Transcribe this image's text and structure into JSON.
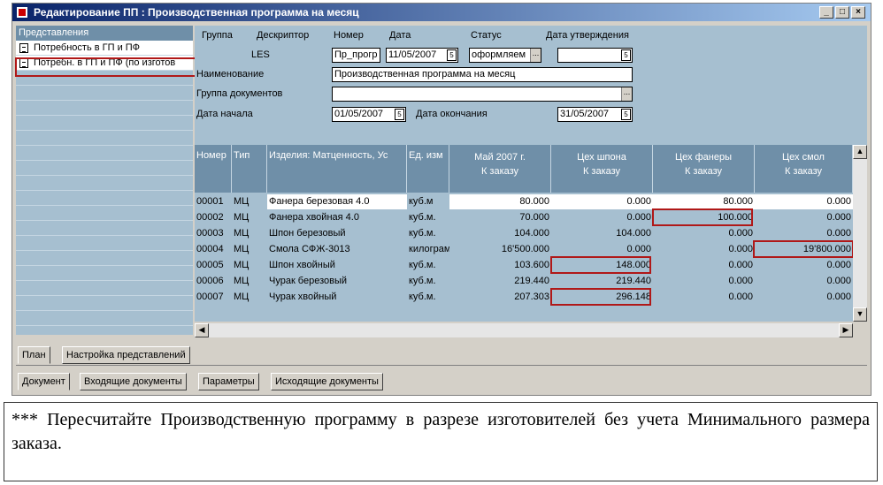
{
  "window": {
    "title": "Редактирование ПП : Производственная программа на месяц"
  },
  "title_buttons": [
    "_",
    "□",
    "×"
  ],
  "left_panel": {
    "header": "Представления",
    "items": [
      "Потребность в ГП и ПФ",
      "Потребн. в ГП и ПФ (по изготов"
    ]
  },
  "form": {
    "labels": {
      "group": "Группа",
      "descriptor": "Дескриптор",
      "number": "Номер",
      "date": "Дата",
      "status": "Статус",
      "approval_date": "Дата утверждения",
      "name": "Наименование",
      "doc_group": "Группа документов",
      "start_date": "Дата начала",
      "end_date": "Дата окончания"
    },
    "values": {
      "descriptor": "LES",
      "number": "Пр_прогр",
      "date": "11/05/2007",
      "status": "оформляем",
      "approval_date": "",
      "name": "Производственная программа на месяц",
      "doc_group": "",
      "start_date": "01/05/2007",
      "end_date": "31/05/2007"
    }
  },
  "grid": {
    "columns": [
      {
        "id": "num",
        "label": "Номер"
      },
      {
        "id": "type",
        "label": "Тип"
      },
      {
        "id": "item",
        "label": "Изделия: Матценность, Ус"
      },
      {
        "id": "unit",
        "label": "Ед. изм"
      },
      {
        "id": "may",
        "label1": "Май 2007 г.",
        "label2": "К заказу"
      },
      {
        "id": "veneer",
        "label1": "Цех шпона",
        "label2": "К заказу"
      },
      {
        "id": "plywood",
        "label1": "Цех фанеры",
        "label2": "К заказу"
      },
      {
        "id": "resin",
        "label1": "Цех смол",
        "label2": "К заказу"
      }
    ],
    "rows": [
      {
        "num": "00001",
        "type": "МЦ",
        "item": "Фанера березовая 4.0",
        "unit": "куб.м",
        "may": "80.000",
        "veneer": "0.000",
        "plywood": "80.000",
        "resin": "0.000"
      },
      {
        "num": "00002",
        "type": "МЦ",
        "item": "Фанера хвойная 4.0",
        "unit": "куб.м.",
        "may": "70.000",
        "veneer": "0.000",
        "plywood": "100.000",
        "resin": "0.000"
      },
      {
        "num": "00003",
        "type": "МЦ",
        "item": "Шпон березовый",
        "unit": "куб.м.",
        "may": "104.000",
        "veneer": "104.000",
        "plywood": "0.000",
        "resin": "0.000"
      },
      {
        "num": "00004",
        "type": "МЦ",
        "item": "Смола СФЖ-3013",
        "unit": "килограм",
        "may": "16'500.000",
        "veneer": "0.000",
        "plywood": "0.000",
        "resin": "19'800.000"
      },
      {
        "num": "00005",
        "type": "МЦ",
        "item": "Шпон хвойный",
        "unit": "куб.м.",
        "may": "103.600",
        "veneer": "148.000",
        "plywood": "0.000",
        "resin": "0.000"
      },
      {
        "num": "00006",
        "type": "МЦ",
        "item": "Чурак березовый",
        "unit": "куб.м.",
        "may": "219.440",
        "veneer": "219.440",
        "plywood": "0.000",
        "resin": "0.000"
      },
      {
        "num": "00007",
        "type": "МЦ",
        "item": "Чурак хвойный",
        "unit": "куб.м.",
        "may": "207.303",
        "veneer": "296.148",
        "plywood": "0.000",
        "resin": "0.000"
      }
    ]
  },
  "tabs_top": [
    "План",
    "Настройка представлений"
  ],
  "tabs_bottom": [
    "Документ",
    "Входящие документы",
    "Параметры",
    "Исходящие документы"
  ],
  "note": "*** Пересчитайте Производственную программу в разрезе изготовителей без учета Минимального размера заказа.",
  "colors": {
    "panel": "#a6bfd0",
    "header": "#6f8fa8",
    "highlight": "#b01818",
    "window": "#d4d0c8"
  }
}
